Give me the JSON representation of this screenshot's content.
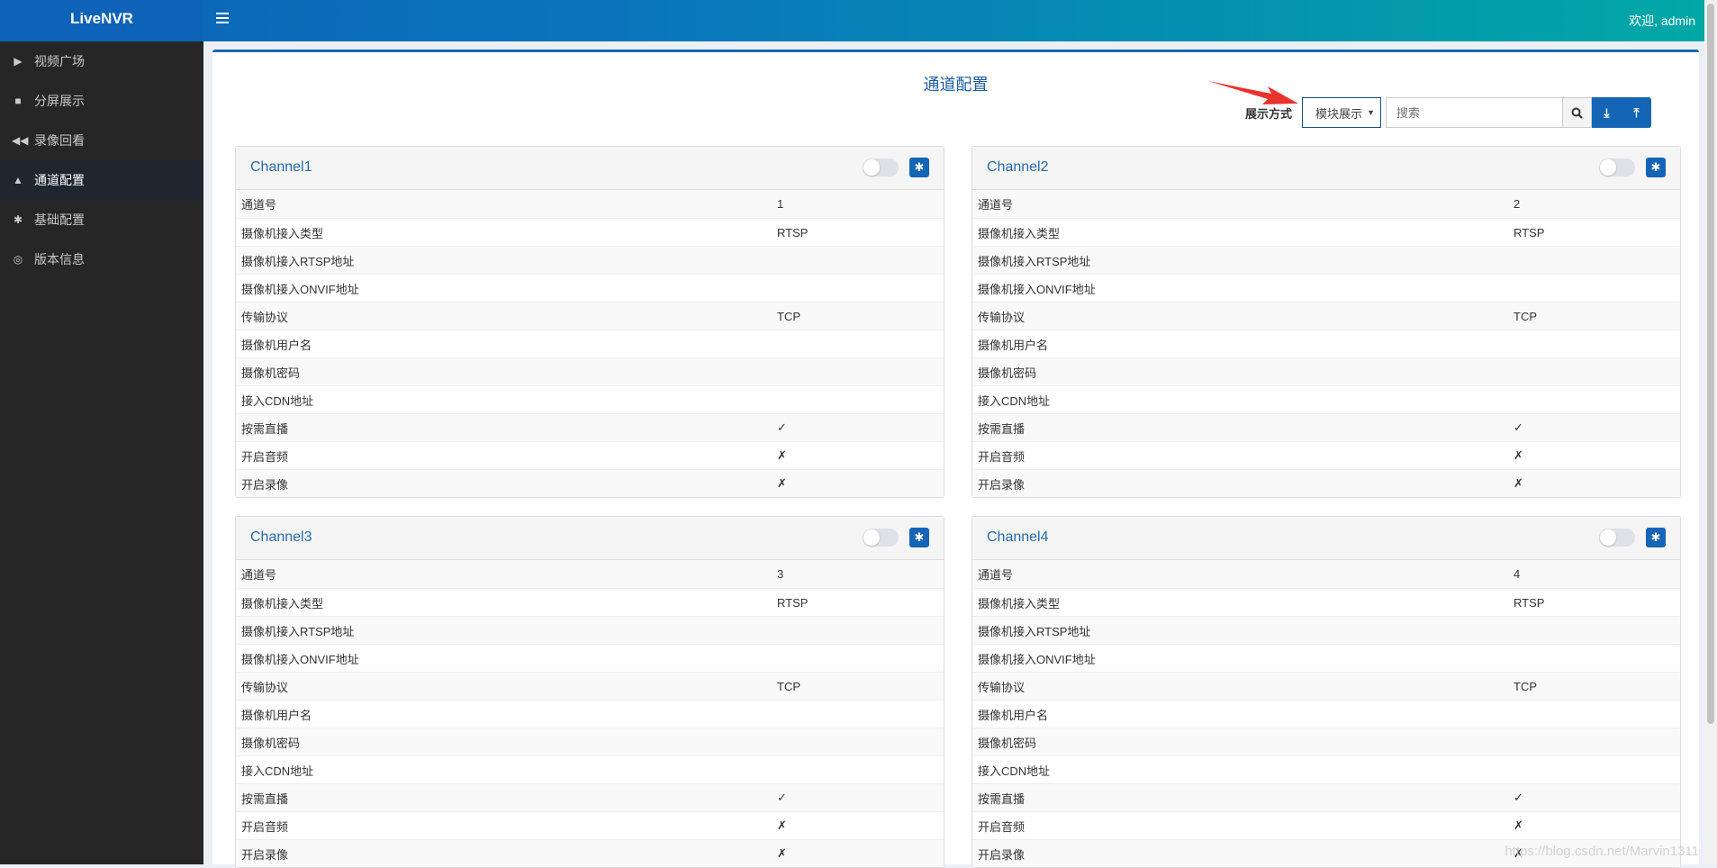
{
  "app": {
    "title": "LiveNVR",
    "welcome": "欢迎, admin"
  },
  "sidebar": {
    "items": [
      {
        "label": "视频广场",
        "icon": "play-icon",
        "glyph": "▶"
      },
      {
        "label": "分屏展示",
        "icon": "grid-icon",
        "glyph": "■"
      },
      {
        "label": "录像回看",
        "icon": "rewind-icon",
        "glyph": "◀◀"
      },
      {
        "label": "通道配置",
        "icon": "road-icon",
        "glyph": "▲",
        "active": true
      },
      {
        "label": "基础配置",
        "icon": "gear-icon",
        "glyph": "✱"
      },
      {
        "label": "版本信息",
        "icon": "lifebuoy-icon",
        "glyph": "◎"
      }
    ]
  },
  "main": {
    "title": "通道配置",
    "toolbar": {
      "display_label": "展示方式",
      "display_value": "模块展示",
      "search_placeholder": "搜索"
    },
    "channels": [
      {
        "name": "Channel1",
        "enabled": false,
        "rows": [
          [
            "通道号",
            "1"
          ],
          [
            "摄像机接入类型",
            "RTSP"
          ],
          [
            "摄像机接入RTSP地址",
            ""
          ],
          [
            "摄像机接入ONVIF地址",
            ""
          ],
          [
            "传输协议",
            "TCP"
          ],
          [
            "摄像机用户名",
            ""
          ],
          [
            "摄像机密码",
            ""
          ],
          [
            "接入CDN地址",
            ""
          ],
          [
            "按需直播",
            "✓"
          ],
          [
            "开启音频",
            "✗"
          ],
          [
            "开启录像",
            "✗"
          ]
        ]
      },
      {
        "name": "Channel2",
        "enabled": false,
        "rows": [
          [
            "通道号",
            "2"
          ],
          [
            "摄像机接入类型",
            "RTSP"
          ],
          [
            "摄像机接入RTSP地址",
            ""
          ],
          [
            "摄像机接入ONVIF地址",
            ""
          ],
          [
            "传输协议",
            "TCP"
          ],
          [
            "摄像机用户名",
            ""
          ],
          [
            "摄像机密码",
            ""
          ],
          [
            "接入CDN地址",
            ""
          ],
          [
            "按需直播",
            "✓"
          ],
          [
            "开启音频",
            "✗"
          ],
          [
            "开启录像",
            "✗"
          ]
        ]
      },
      {
        "name": "Channel3",
        "enabled": false,
        "rows": [
          [
            "通道号",
            "3"
          ],
          [
            "摄像机接入类型",
            "RTSP"
          ],
          [
            "摄像机接入RTSP地址",
            ""
          ],
          [
            "摄像机接入ONVIF地址",
            ""
          ],
          [
            "传输协议",
            "TCP"
          ],
          [
            "摄像机用户名",
            ""
          ],
          [
            "摄像机密码",
            ""
          ],
          [
            "接入CDN地址",
            ""
          ],
          [
            "按需直播",
            "✓"
          ],
          [
            "开启音频",
            "✗"
          ],
          [
            "开启录像",
            "✗"
          ]
        ]
      },
      {
        "name": "Channel4",
        "enabled": false,
        "rows": [
          [
            "通道号",
            "4"
          ],
          [
            "摄像机接入类型",
            "RTSP"
          ],
          [
            "摄像机接入RTSP地址",
            ""
          ],
          [
            "摄像机接入ONVIF地址",
            ""
          ],
          [
            "传输协议",
            "TCP"
          ],
          [
            "摄像机用户名",
            ""
          ],
          [
            "摄像机密码",
            ""
          ],
          [
            "接入CDN地址",
            ""
          ],
          [
            "按需直播",
            "✓"
          ],
          [
            "开启音频",
            "✗"
          ],
          [
            "开启录像",
            "✗"
          ]
        ]
      }
    ]
  },
  "watermark": "https://blog.csdn.net/Marvin1311",
  "colors": {
    "primary": "#1465b6",
    "header_end": "#00a8a6",
    "sidebar": "#262626",
    "annotation_arrow": "#e8342c"
  }
}
